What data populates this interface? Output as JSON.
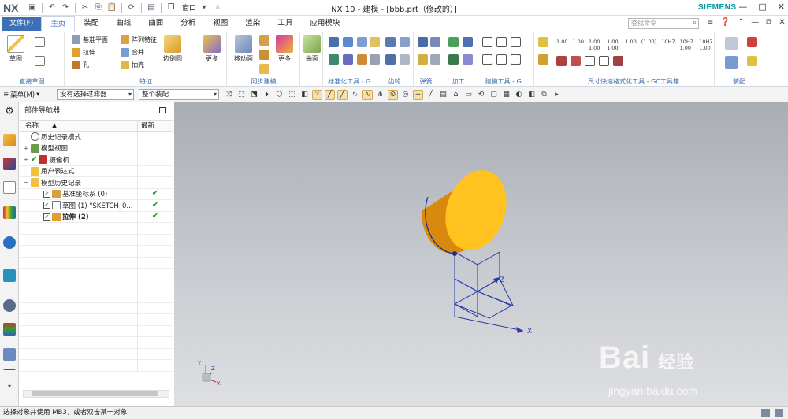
{
  "app": {
    "logo": "NX",
    "title": "NX 10 - 建模 - [bbb.prt（修改的）]",
    "brand": "SIEMENS",
    "window_menu": "窗口",
    "window_controls": [
      "—",
      "□",
      "✕"
    ]
  },
  "tabs": {
    "file": "文件(F)",
    "items": [
      "主页",
      "装配",
      "曲线",
      "曲面",
      "分析",
      "视图",
      "渲染",
      "工具",
      "应用模块"
    ],
    "active": "主页",
    "search_placeholder": "查找命令",
    "right_controls": [
      "≡",
      "❓",
      "⌃",
      "—",
      "⧉",
      "✕"
    ]
  },
  "ribbon": {
    "sketch_group": {
      "label": "直接草图",
      "sketch": "草图"
    },
    "feature_group": {
      "label": "特征",
      "datum_plane": "基准平面",
      "extrude": "拉伸",
      "hole": "孔",
      "pattern": "阵列特征",
      "unite": "合并",
      "shell": "抽壳",
      "edge_blend": "边倒圆",
      "more": "更多"
    },
    "sync_group": {
      "label": "同步建模",
      "move_face": "移动面",
      "more": "更多"
    },
    "surface_group": {
      "label": "",
      "surface": "曲面"
    },
    "std_group": {
      "label": "标准化工具 - G..."
    },
    "gear_group": {
      "label": "齿轮..."
    },
    "spring_group": {
      "label": "弹簧..."
    },
    "machining_group": {
      "label": "加工..."
    },
    "modeling_tools_group": {
      "label": "建模工具 - G..."
    },
    "dim_group": {
      "label": "尺寸快速格式化工具 - GC工具箱",
      "dims": [
        "1.00",
        "1.00",
        "1.00 1.00",
        "1.00 1.00",
        "1.00",
        "(1.00)",
        "10H7",
        "10H7 1.00",
        "10H7 1.00"
      ]
    },
    "assembly_group": {
      "label": "装配"
    }
  },
  "selection_bar": {
    "menu": "菜单(M)",
    "filter": "没有选择过滤器",
    "scope": "整个装配"
  },
  "navigator": {
    "title": "部件导航器",
    "col_name": "名称",
    "col_latest": "最新",
    "rows": [
      {
        "name": "历史记录模式",
        "level": 0,
        "status": ""
      },
      {
        "name": "模型视图",
        "level": 0,
        "status": ""
      },
      {
        "name": "摄像机",
        "level": 0,
        "status": ""
      },
      {
        "name": "用户表达式",
        "level": 0,
        "status": ""
      },
      {
        "name": "模型历史记录",
        "level": 0,
        "status": ""
      },
      {
        "name": "基准坐标系 (0)",
        "level": 1,
        "status": "✔"
      },
      {
        "name": "草图 (1) \"SKETCH_0...",
        "level": 1,
        "status": "✔"
      },
      {
        "name": "拉伸 (2)",
        "level": 1,
        "status": "✔"
      }
    ]
  },
  "viewport": {
    "axis_labels": {
      "x": "X",
      "y": "Y",
      "z": "Z"
    },
    "triad_labels": {
      "x": "X",
      "y": "Y",
      "z": "Z"
    },
    "body_color": "#f0a21a",
    "body_top_color": "#ffc21e"
  },
  "watermark": {
    "text": "Bai",
    "text2": "经验",
    "url": "jingyan.baidu.com"
  },
  "status": {
    "text": "选择对象并使用 MB3，或者双击某一对象"
  }
}
